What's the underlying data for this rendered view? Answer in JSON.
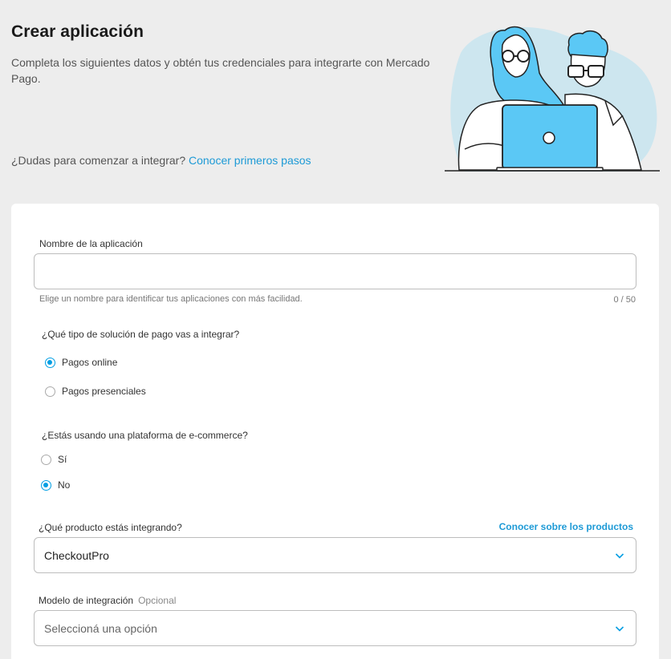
{
  "header": {
    "title": "Crear aplicación",
    "subtitle": "Completa los siguientes datos y obtén tus credenciales para integrarte con Mercado Pago.",
    "help_text": "¿Dudas para comenzar a integrar?",
    "help_link": "Conocer primeros pasos"
  },
  "form": {
    "app_name": {
      "label": "Nombre de la aplicación",
      "value": "",
      "placeholder": "",
      "helper": "Elige un nombre para identificar tus aplicaciones con más facilidad.",
      "counter": "0 / 50"
    },
    "solution_type": {
      "question": "¿Qué tipo de solución de pago vas a integrar?",
      "options": [
        {
          "label": "Pagos online",
          "checked": true
        },
        {
          "label": "Pagos presenciales",
          "checked": false
        }
      ]
    },
    "ecommerce": {
      "question": "¿Estás usando una plataforma de e-commerce?",
      "options": [
        {
          "label": "Sí",
          "checked": false
        },
        {
          "label": "No",
          "checked": true
        }
      ]
    },
    "product": {
      "label": "¿Qué producto estás integrando?",
      "link": "Conocer sobre los productos",
      "value": "CheckoutPro"
    },
    "integration_model": {
      "label": "Modelo de integración",
      "optional": "Opcional",
      "placeholder": "Seleccioná una opción"
    }
  },
  "colors": {
    "accent": "#009ee3",
    "link": "#1d9ad6",
    "illustration_blue": "#5bc8f5",
    "illustration_bg": "#cde6ef"
  }
}
